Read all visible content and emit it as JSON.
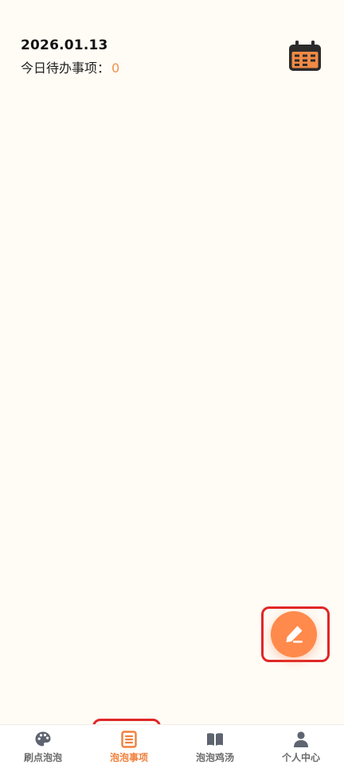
{
  "header": {
    "date": "2026.01.13",
    "todo_label": "今日待办事项：",
    "todo_count": "0",
    "calendar_icon": "calendar-icon"
  },
  "fab": {
    "icon": "pencil-icon",
    "color": "#FF8A4C"
  },
  "tabbar": {
    "tabs": [
      {
        "label": "刷点泡泡",
        "icon": "palette-icon",
        "active": false
      },
      {
        "label": "泡泡事项",
        "icon": "list-icon",
        "active": true
      },
      {
        "label": "泡泡鸡汤",
        "icon": "book-icon",
        "active": false
      },
      {
        "label": "个人中心",
        "icon": "user-icon",
        "active": false
      }
    ]
  },
  "colors": {
    "background": "#FFFBF5",
    "accent": "#F0803C",
    "highlight": "#E02727"
  }
}
